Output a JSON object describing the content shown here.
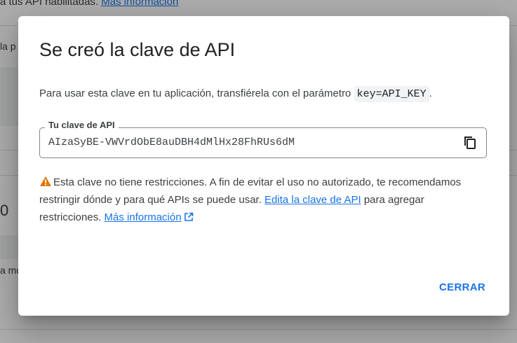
{
  "background": {
    "top_text": "a tus API habilitadas.",
    "top_link": "Más información",
    "side_text_1": "la p",
    "side_text_2": "0",
    "side_text_3": "a mo"
  },
  "dialog": {
    "title": "Se creó la clave de API",
    "description_prefix": "Para usar esta clave en tu aplicación, transfiérela con el parámetro",
    "param_code": "key=API_KEY",
    "description_suffix": ".",
    "field": {
      "label": "Tu clave de API",
      "value": "AIzaSyBE-VWVrdObE8auDBH4dMlHx28FhRUs6dM"
    },
    "warning": {
      "text_1": "Esta clave no tiene restricciones. A fin de evitar el uso no autorizado, te recomendamos restringir dónde y para qué APIs se puede usar.",
      "edit_link": "Edita la clave de API",
      "text_2": "para agregar restricciones.",
      "more_info_link": "Más información"
    },
    "close_label": "CERRAR"
  },
  "icons": {
    "copy": "copy-icon",
    "warning": "warning-icon",
    "external": "external-link-icon"
  },
  "colors": {
    "accent": "#1a73e8",
    "warning": "#e37400",
    "text": "#3c4043"
  }
}
